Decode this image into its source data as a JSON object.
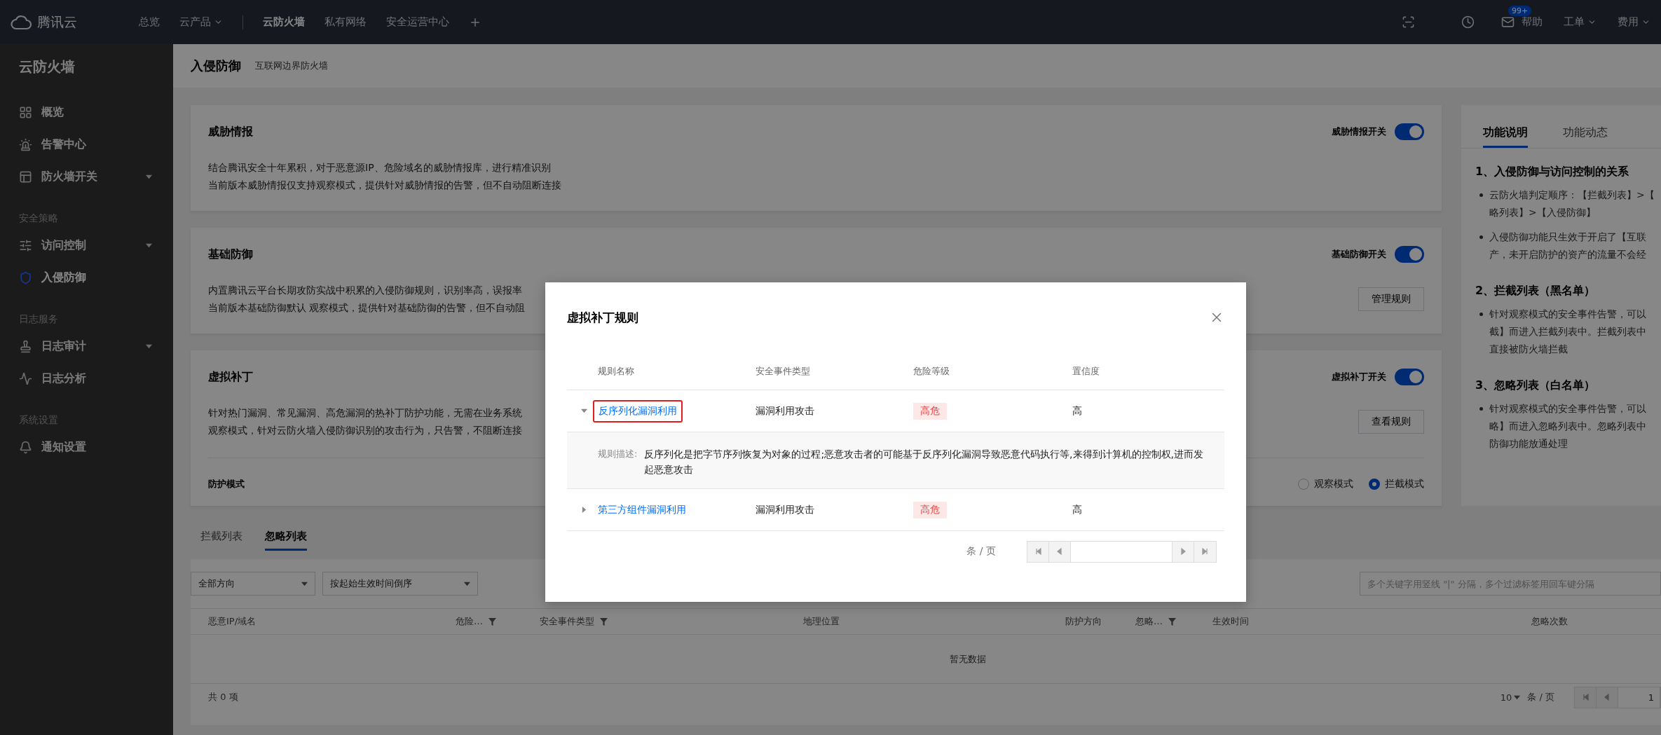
{
  "top_bar": {
    "brand": "腾讯云",
    "menus": [
      {
        "label": "总览",
        "dropdown": false
      },
      {
        "label": "云产品",
        "dropdown": true
      }
    ],
    "product_tabs": [
      {
        "label": "云防火墙",
        "selected": true
      },
      {
        "label": "私有网络",
        "selected": false
      },
      {
        "label": "安全运营中心",
        "selected": false
      }
    ],
    "badge": "99+",
    "links": [
      {
        "label": "帮助",
        "dropdown": false
      },
      {
        "label": "工单",
        "dropdown": true
      },
      {
        "label": "费用",
        "dropdown": true
      }
    ]
  },
  "sidebar": {
    "title": "云防火墙",
    "groups": [
      {
        "items": [
          {
            "label": "概览",
            "selected": false,
            "has_submenu": false
          },
          {
            "label": "告警中心",
            "selected": false,
            "has_submenu": false
          },
          {
            "label": "防火墙开关",
            "selected": false,
            "has_submenu": true
          }
        ]
      },
      {
        "label": "安全策略",
        "items": [
          {
            "label": "访问控制",
            "selected": false,
            "has_submenu": true
          },
          {
            "label": "入侵防御",
            "selected": true,
            "has_submenu": false
          }
        ]
      },
      {
        "label": "日志服务",
        "items": [
          {
            "label": "日志审计",
            "selected": false,
            "has_submenu": true
          },
          {
            "label": "日志分析",
            "selected": false,
            "has_submenu": false
          }
        ]
      },
      {
        "label": "系统设置",
        "items": [
          {
            "label": "通知设置",
            "selected": false,
            "has_submenu": false
          }
        ]
      }
    ]
  },
  "header": {
    "title": "入侵防御",
    "subtitle": "互联网边界防火墙"
  },
  "cards": [
    {
      "title": "威胁情报",
      "switch_label": "威胁情报开关",
      "on": true,
      "lines": [
        "结合腾讯安全十年累积，对于恶意源IP、危险域名的威胁情报库，进行精准识别",
        "当前版本威胁情报仅支持观察模式，提供针对威胁情报的告警，但不自动阻断连接"
      ]
    },
    {
      "title": "基础防御",
      "switch_label": "基础防御开关",
      "on": true,
      "lines": [
        "内置腾讯云平台长期攻防实战中积累的入侵防御规则，识别率高，误报率",
        "当前版本基础防御默认 观察模式，提供针对基础防御的告警，但不自动阻"
      ],
      "button": "管理规则"
    },
    {
      "title": "虚拟补丁",
      "switch_label": "虚拟补丁开关",
      "on": true,
      "lines": [
        "针对热门漏洞、常见漏洞、高危漏洞的热补丁防护功能，无需在业务系统",
        "观察模式，针对云防火墙入侵防御识别的攻击行为，只告警，不阻断连接"
      ],
      "button": "查看规则",
      "mode": {
        "label": "防护模式",
        "options": [
          {
            "label": "观察模式",
            "selected": false
          },
          {
            "label": "拦截模式",
            "selected": true
          }
        ]
      }
    }
  ],
  "info_panel": {
    "tabs": [
      {
        "label": "功能说明",
        "selected": true
      },
      {
        "label": "功能动态",
        "selected": false
      }
    ],
    "sections": [
      {
        "heading": "1、入侵防御与访问控制的关系",
        "bullets": [
          [
            "云防火墙判定顺序：【拦截列表】>【",
            "略列表】>【入侵防御】"
          ],
          [
            "入侵防御功能只生效于开启了【互联",
            "产，未开启防护的资产的流量不会经"
          ]
        ]
      },
      {
        "heading": "2、拦截列表（黑名单）",
        "bullets": [
          [
            "针对观察模式的安全事件告警，可以",
            "截】而进入拦截列表中。拦截列表中",
            "直接被防火墙拦截"
          ]
        ]
      },
      {
        "heading": "3、忽略列表（白名单）",
        "bullets": [
          [
            "针对观察模式的安全事件告警，可以",
            "略】而进入忽略列表中。忽略列表中",
            "防御功能放通处理"
          ]
        ]
      }
    ]
  },
  "list_tabs": [
    {
      "label": "拦截列表",
      "selected": false
    },
    {
      "label": "忽略列表",
      "selected": true
    }
  ],
  "filters": {
    "direction": "全部方向",
    "sort": "按起始生效时间倒序",
    "search_placeholder": "多个关键字用竖线 \"|\" 分隔，多个过滤标签用回车键分隔"
  },
  "table": {
    "columns": [
      {
        "label": "恶意IP/域名",
        "filter": false
      },
      {
        "label": "危险…",
        "filter": true
      },
      {
        "label": "安全事件类型",
        "filter": true
      },
      {
        "label": "地理位置",
        "filter": false
      },
      {
        "label": "防护方向",
        "filter": false
      },
      {
        "label": "忽略…",
        "filter": true
      },
      {
        "label": "生效时间",
        "filter": false
      },
      {
        "label": "忽略次数",
        "filter": false
      }
    ],
    "empty": "暂无数据",
    "total": "共 0 项",
    "page_size": "10",
    "per_page": "条 / 页",
    "page": "1"
  },
  "modal": {
    "title": "虚拟补丁规则",
    "columns": [
      "规则名称",
      "安全事件类型",
      "危险等级",
      "置信度"
    ],
    "rows": [
      {
        "name": "反序列化漏洞利用",
        "event_type": "漏洞利用攻击",
        "level": "高危",
        "confidence": "高",
        "expanded": true,
        "highlighted": true,
        "description_label": "规则描述:",
        "description": "反序列化是把字节序列恢复为对象的过程;恶意攻击者的可能基于反序列化漏洞导致恶意代码执行等,来得到计算机的控制权,进而发起恶意攻击"
      },
      {
        "name": "第三方组件漏洞利用",
        "event_type": "漏洞利用攻击",
        "level": "高危",
        "confidence": "高",
        "expanded": false,
        "highlighted": false
      }
    ],
    "per_page": "条 / 页"
  }
}
